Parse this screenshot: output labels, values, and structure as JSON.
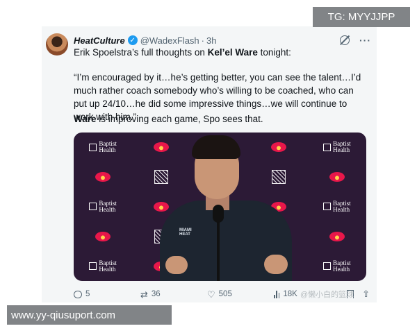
{
  "tweet": {
    "display_name": "HeatCulture",
    "handle": "@WadexFlash",
    "separator": "·",
    "time": "3h",
    "line1_prefix": "Erik Spoelstra’s full thoughts on ",
    "line1_bold": "Kel’el Ware",
    "line1_suffix": " tonight:",
    "quote": "“I’m encouraged by it…he’s getting better, you can see the talent…I’d much rather coach somebody who’s willing to be coached, who can put up 24/10…he did some impressive things…we will continue to work with him.”",
    "line3_bold": "Ware",
    "line3_suffix": " is improving each game, Spo sees that.",
    "replies": "5",
    "reposts": "36",
    "likes": "505",
    "views": "18K"
  },
  "media": {
    "sponsor_text": [
      "Baptist",
      "Health"
    ],
    "jacket_text": [
      "MIAMI",
      "HEAT"
    ]
  },
  "overlay": {
    "weibo_watermark": "@懒小白的篮球",
    "tg_banner": "TG: MYYJJPP",
    "url_banner": "www.yy-qiusuport.com"
  },
  "colors": {
    "verified": "#1d9bf0",
    "secondary_text": "#536471",
    "banner_bg": "#818487",
    "backdrop": "#2c1a36"
  },
  "icons": {
    "reply": "speech-bubble",
    "repost": "arrows-loop",
    "like": "heart",
    "views": "bar-chart",
    "bookmark": "bookmark",
    "share": "upload-arrow",
    "grok": "slashed-circle",
    "more": "ellipsis"
  }
}
